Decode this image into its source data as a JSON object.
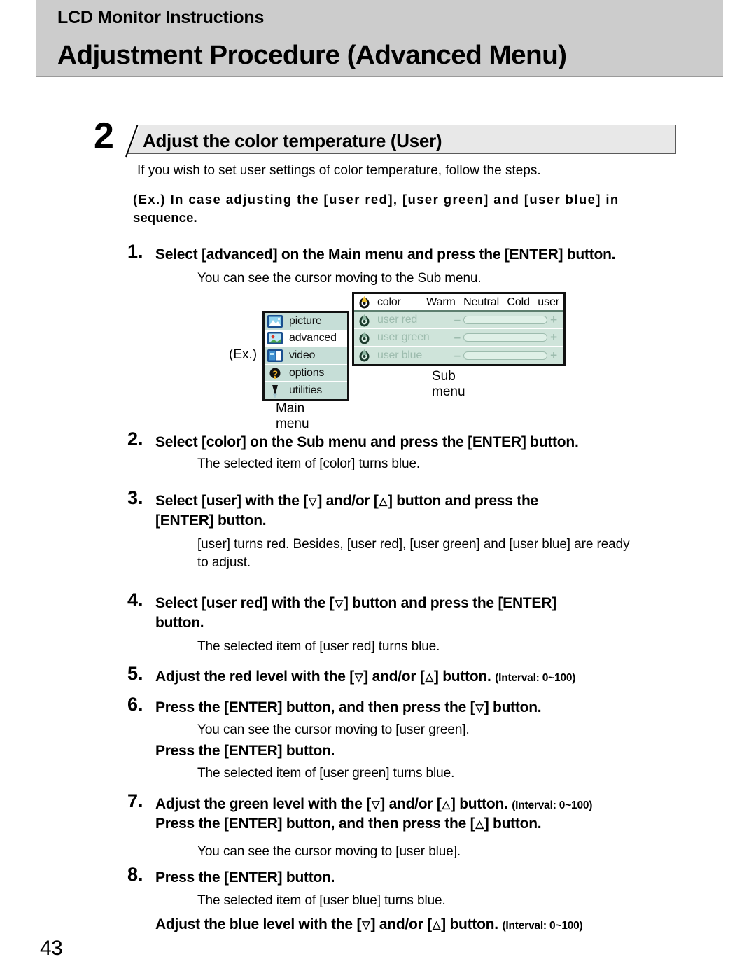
{
  "header": {
    "kicker": "LCD Monitor Instructions",
    "title": "Adjustment Procedure (Advanced Menu)"
  },
  "section": {
    "number": "2",
    "title": "Adjust the color temperature (User)",
    "intro": "If you wish to set user settings of color temperature, follow the steps.",
    "ex_note_prefix": "(Ex.) In case adjusting the [user red], [user green] and [user blue] in",
    "ex_note_suffix": "sequence."
  },
  "steps": {
    "s1_num": "1.",
    "s1_text": "Select [advanced] on the Main menu and press the [ENTER] button.",
    "s1_sub": "You can see the cursor moving to the Sub menu.",
    "s2_num": "2.",
    "s2_text": "Select [color] on the Sub menu and press the [ENTER] button.",
    "s2_sub": "The selected item of [color] turns blue.",
    "s3_num": "3.",
    "s3_text_a": "Select [user] with the [",
    "s3_text_b": "] and/or [",
    "s3_text_c": "] button and press the",
    "s3_text_d": "[ENTER] button.",
    "s3_sub_1": "[user] turns red. Besides, [user red], [user green] and [user blue] are ready",
    "s3_sub_2": "to adjust.",
    "s4_num": "4.",
    "s4_text_a": "Select [user red] with the [",
    "s4_text_b": "] button and press the [ENTER]",
    "s4_text_c": "button.",
    "s4_sub": "The selected item of [user red] turns blue.",
    "s5_num": "5.",
    "s5_text_a": "Adjust the red level with the [",
    "s5_text_b": "] and/or [",
    "s5_text_c": "] button.",
    "s5_interval": "(Interval: 0~100)",
    "s6_num": "6.",
    "s6_text_a": "Press the [ENTER] button, and then press the [",
    "s6_text_b": "] button.",
    "s6_sub": "You can see the cursor moving to [user green].",
    "s6_text2": "Press the [ENTER] button.",
    "s6_sub2": "The selected item of [user green] turns blue.",
    "s7_num": "7.",
    "s7_text_a": "Adjust the green level with the [",
    "s7_text_b": "] and/or [",
    "s7_text_c": "] button.",
    "s7_interval": "(Interval: 0~100)",
    "s7_text2_a": "Press the [ENTER] button, and then press the [",
    "s7_text2_b": "] button.",
    "s7_sub": "You can see the cursor moving to [user blue].",
    "s8_num": "8.",
    "s8_text": "Press the [ENTER] button.",
    "s8_sub": "The selected item of [user blue] turns blue.",
    "s8_text2_a": "Adjust the blue level with the [",
    "s8_text2_b": "] and/or [",
    "s8_text2_c": "] button.",
    "s8_interval": "(Interval: 0~100)"
  },
  "glyphs": {
    "down": "▽",
    "up": "△"
  },
  "diagram": {
    "ex_label": "(Ex.)",
    "main_menu_caption": "Main menu",
    "sub_menu_caption": "Sub menu",
    "main_menu_items": [
      {
        "label": "picture",
        "icon": "picture-icon",
        "selected": false
      },
      {
        "label": "advanced",
        "icon": "advanced-icon",
        "selected": true
      },
      {
        "label": "video",
        "icon": "video-icon",
        "selected": false
      },
      {
        "label": "options",
        "icon": "options-icon",
        "selected": false
      },
      {
        "label": "utilities",
        "icon": "utilities-icon",
        "selected": false
      }
    ],
    "sub_menu_header": {
      "label": "color",
      "icon": "color-palette-icon",
      "options": [
        "Warm",
        "Neutral",
        "Cold",
        "user"
      ]
    },
    "sub_menu_rows": [
      {
        "label": "user  red",
        "icon": "color-palette-icon",
        "minus": "–",
        "plus": "+"
      },
      {
        "label": "user  green",
        "icon": "color-palette-icon",
        "minus": "–",
        "plus": "+"
      },
      {
        "label": "user  blue",
        "icon": "color-palette-icon",
        "minus": "–",
        "plus": "+"
      }
    ]
  },
  "footer": {
    "page_number": "43"
  },
  "colors": {
    "header_gray": "#cccccc",
    "banner_gray": "#e8e8e8",
    "menu_teal": "#c6ded7",
    "submenu_green": "#cfe4da",
    "dim_text": "#9dbcae"
  }
}
